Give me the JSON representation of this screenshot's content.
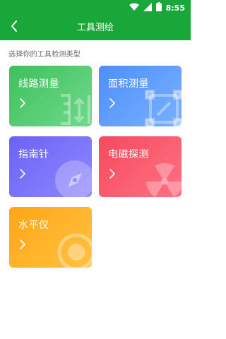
{
  "status_bar": {
    "time": "8:55",
    "background": "#1aa73a"
  },
  "app_bar": {
    "title": "工具测绘",
    "back_icon": "chevron-left-icon"
  },
  "section": {
    "label": "选择你的工具检测类型"
  },
  "tools": [
    {
      "label": "线路测量",
      "color": "#3ec15e",
      "icon": "ruler-icon"
    },
    {
      "label": "面积测量",
      "color": "#4c8efc",
      "icon": "area-frame-icon"
    },
    {
      "label": "指南针",
      "color": "#6a62f5",
      "icon": "compass-icon"
    },
    {
      "label": "电磁探测",
      "color": "#f6495e",
      "icon": "radiation-icon"
    },
    {
      "label": "水平仪",
      "color": "#ffa516",
      "icon": "level-bubble-icon"
    }
  ]
}
